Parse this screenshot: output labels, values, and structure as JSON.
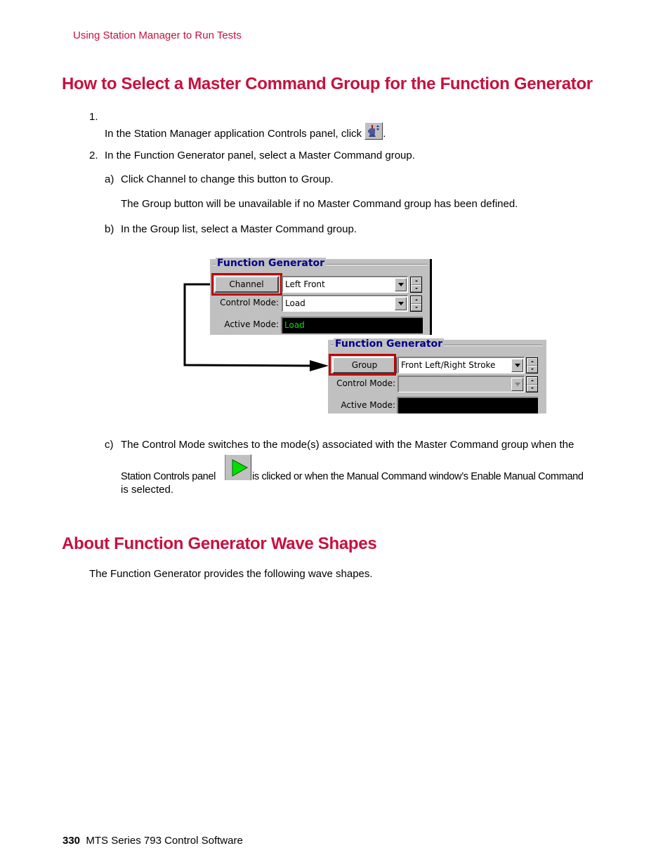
{
  "running_head": "Using Station Manager to Run Tests",
  "section1": {
    "title": "How to Select a Master Command Group for the Function Generator",
    "steps": [
      {
        "number": "1.",
        "text": "In the Station Manager application Controls panel, click",
        "icon": "function-generator-icon",
        "after": "."
      },
      {
        "number": "2.",
        "text": "In the Function Generator panel, select a Master Command group."
      }
    ],
    "substeps": [
      {
        "letter": "a)",
        "text": "Click Channel to change this button to Group.",
        "note": "The Group button will be unavailable if no Master Command group has been defined."
      },
      {
        "letter": "b)",
        "text": "In the Group list, select a Master Command group."
      },
      {
        "letter": "c)",
        "text_line1": "The Control Mode switches to the mode(s) associated with the Master Command group when the",
        "text_before_icon": "Station Controls panel",
        "icon": "run-play-icon",
        "text_after_icon": "is clicked or when the Manual Command window’s Enable Manual Command",
        "text_line3": "is selected."
      }
    ]
  },
  "figure": {
    "panel_before": {
      "title": "Function Generator",
      "toggle_button": "Channel",
      "channel_value": "Left Front",
      "control_mode_label": "Control Mode:",
      "control_mode_value": "Load",
      "active_mode_label": "Active Mode:",
      "active_mode_value": "Load"
    },
    "panel_after": {
      "title": "Function Generator",
      "toggle_button": "Group",
      "group_value": "Front Left/Right Stroke",
      "control_mode_label": "Control Mode:",
      "control_mode_value": "",
      "active_mode_label": "Active Mode:",
      "active_mode_value": ""
    },
    "highlight_color": "#c00000",
    "active_text_color": "#00e000"
  },
  "section2": {
    "title": "About Function Generator Wave Shapes",
    "intro": "The Function Generator provides the following wave shapes."
  },
  "footer": {
    "page_number": "330",
    "doc_title": "MTS Series 793 Control Software"
  },
  "colors": {
    "heading": "#c8103e",
    "panel_bg": "#c0c0c0",
    "panel_title": "#00008b"
  }
}
